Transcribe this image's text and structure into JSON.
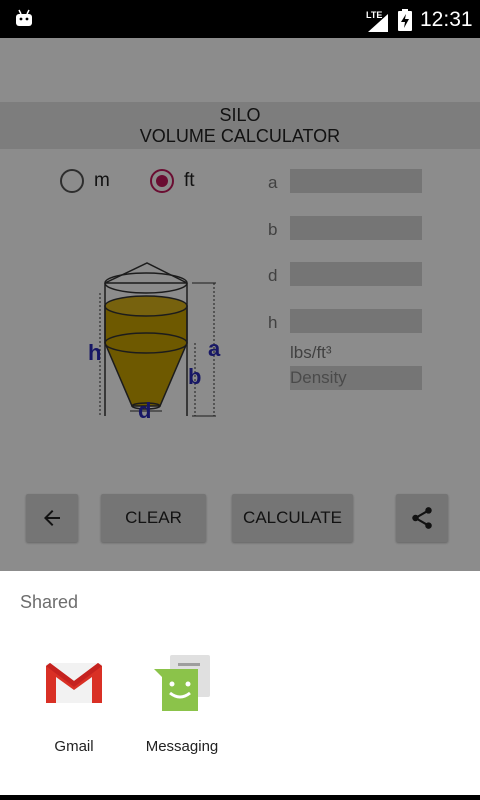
{
  "status_bar": {
    "network": "LTE",
    "time": "12:31"
  },
  "app": {
    "title_line1": "SILO",
    "title_line2": "VOLUME CALCULATOR",
    "units": [
      {
        "label": "m",
        "selected": false
      },
      {
        "label": "ft",
        "selected": true
      }
    ],
    "fields": [
      {
        "label": "a",
        "value": ""
      },
      {
        "label": "b",
        "value": ""
      },
      {
        "label": "d",
        "value": ""
      },
      {
        "label": "h",
        "value": ""
      }
    ],
    "density_unit_label": "lbs/ft³",
    "density_placeholder": "Density",
    "diagram_labels": {
      "h": "h",
      "a": "a",
      "b": "b",
      "d": "d"
    },
    "buttons": {
      "clear": "CLEAR",
      "calculate": "CALCULATE"
    },
    "icons": {
      "back": "arrow-back-icon",
      "share": "share-icon"
    }
  },
  "share_sheet": {
    "title": "Shared",
    "targets": [
      {
        "label": "Gmail",
        "icon": "gmail-icon"
      },
      {
        "label": "Messaging",
        "icon": "messaging-icon"
      }
    ]
  },
  "colors": {
    "radio_accent": "#c2185b",
    "silo_fill": "#c9a200",
    "diagram_label": "#2a2ab8"
  }
}
